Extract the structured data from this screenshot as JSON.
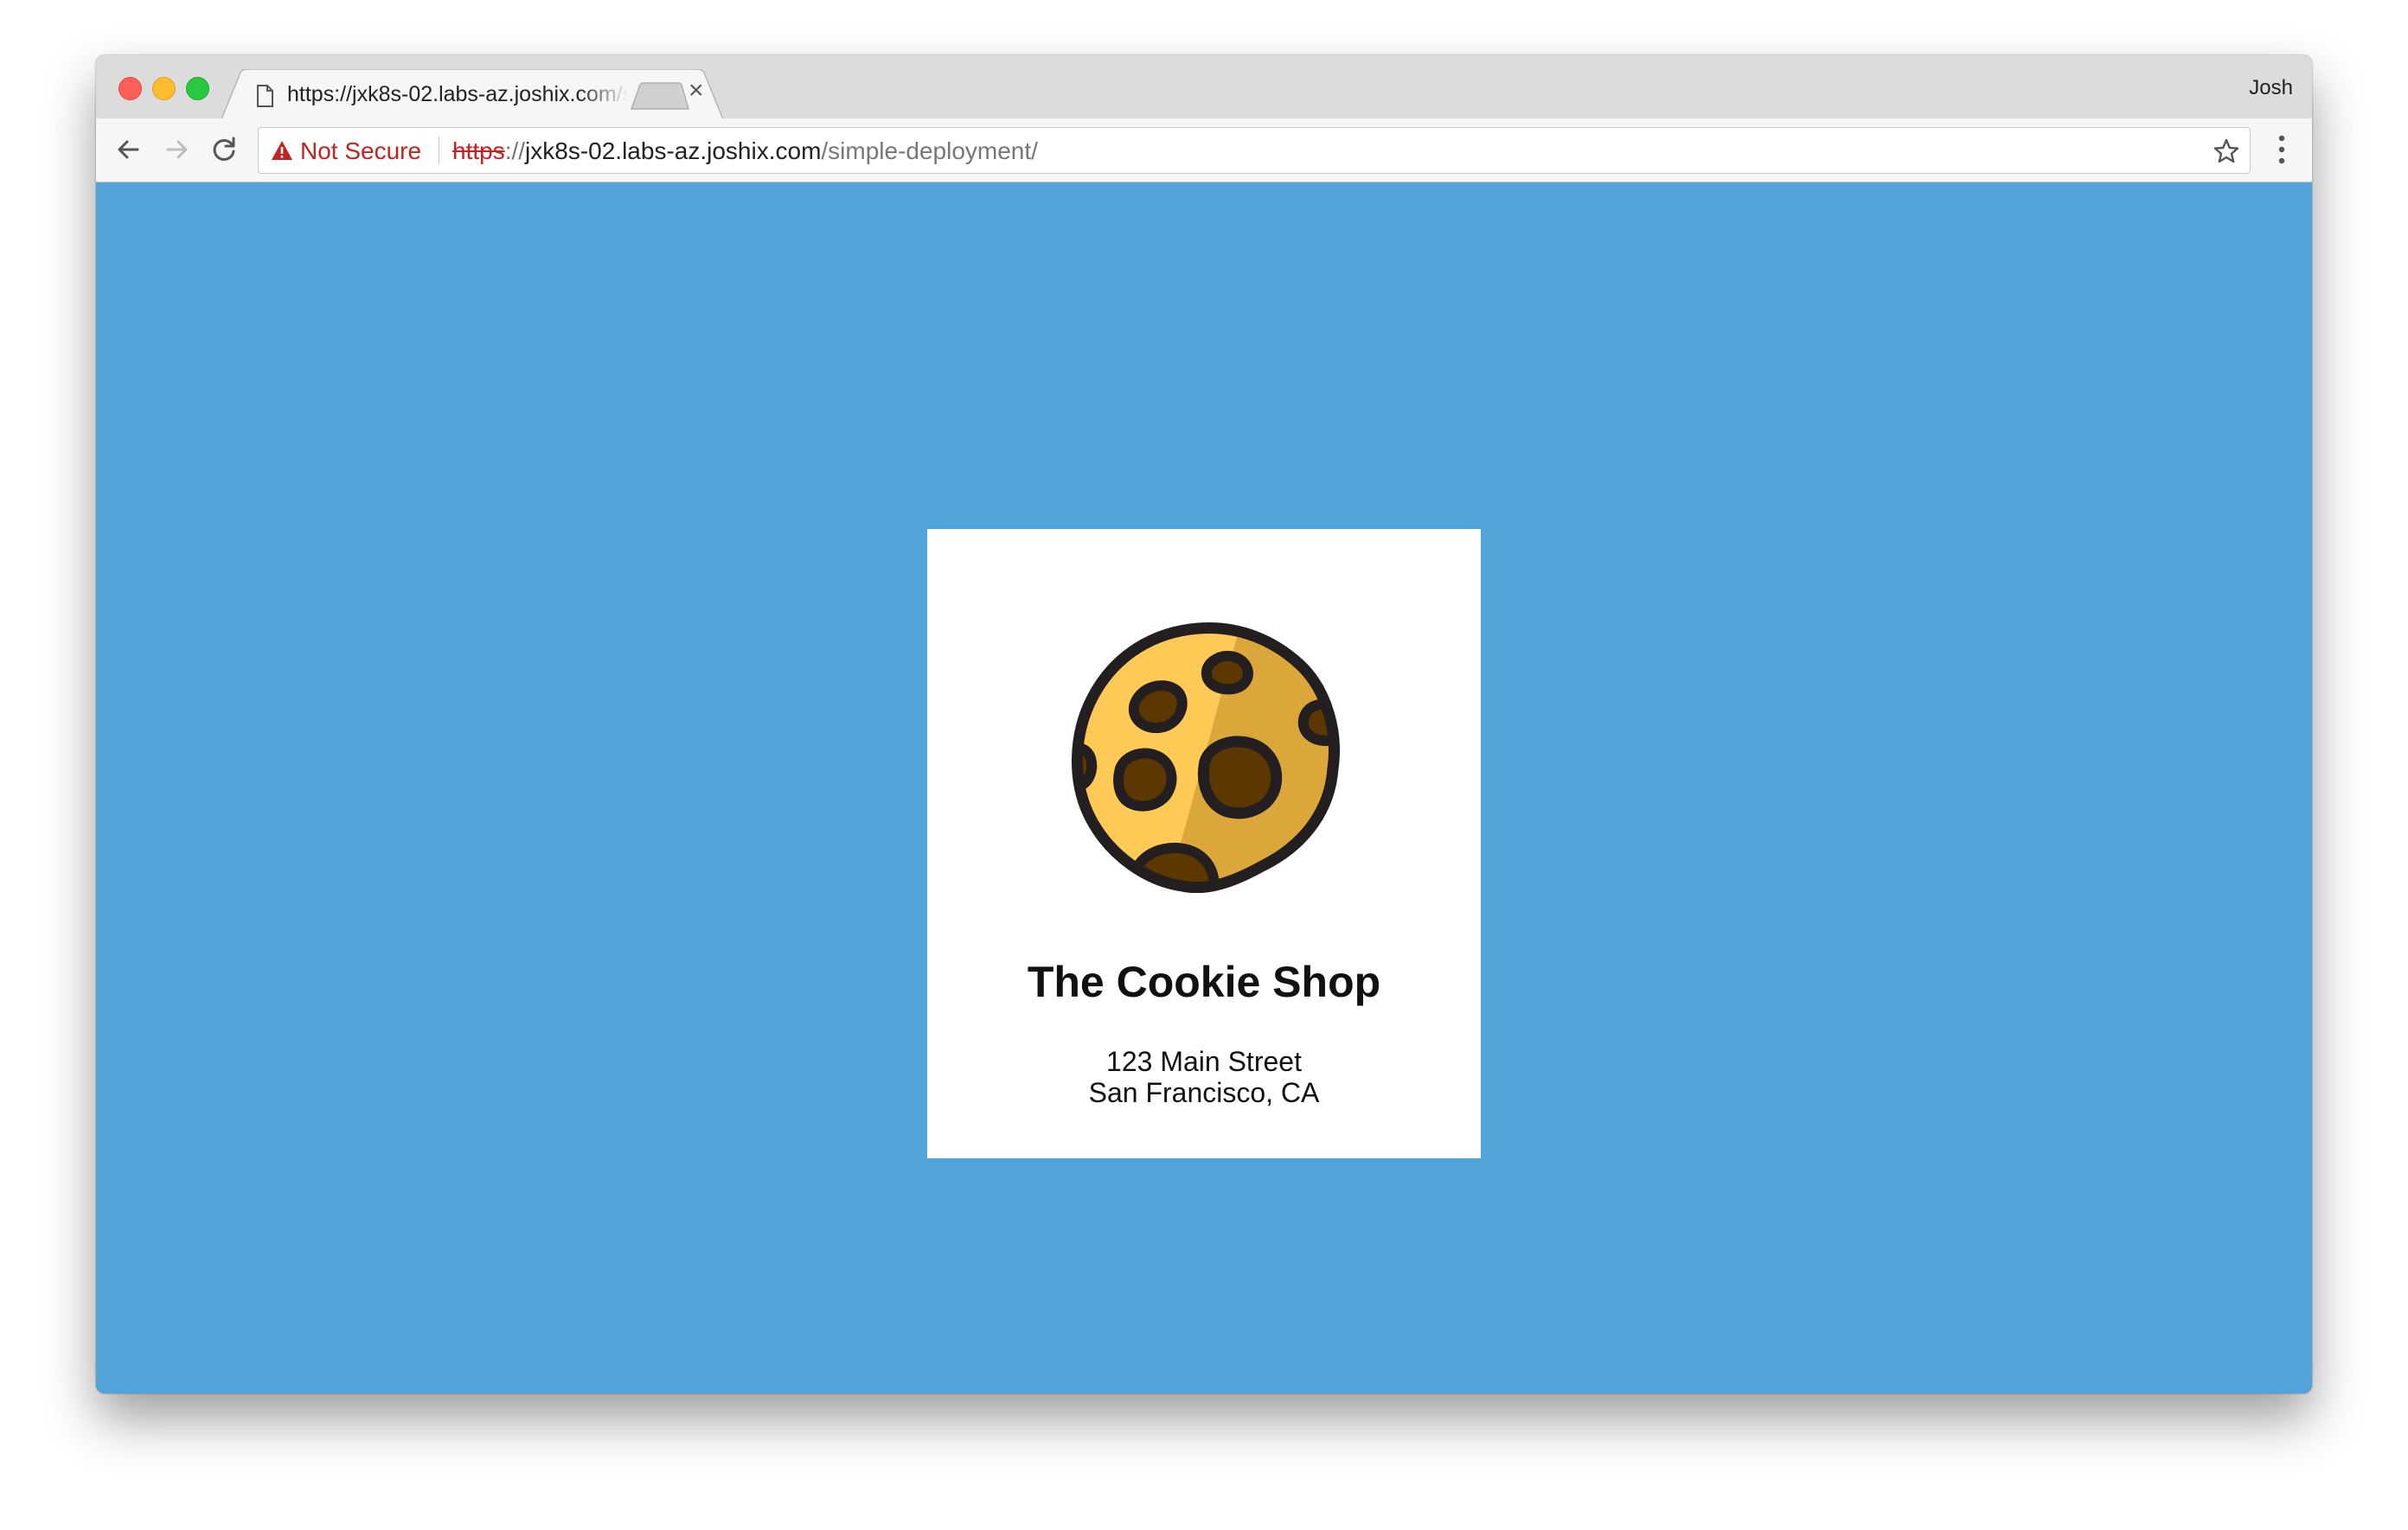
{
  "browser": {
    "tab_title": "https://jxk8s-02.labs-az.joshix.com/simple-deployment/",
    "tab_close": "×",
    "profile_name": "Josh",
    "security_label": "Not Secure",
    "url": {
      "scheme": "https",
      "separator": "://",
      "host": "jxk8s-02.labs-az.joshix.com",
      "path": "/simple-deployment/"
    },
    "icons": {
      "back": "arrow-left-icon",
      "forward": "arrow-right-icon",
      "reload": "reload-icon",
      "warning": "warning-triangle-icon",
      "bookmark": "star-icon",
      "menu": "vertical-dots-icon",
      "page": "document-icon"
    }
  },
  "page": {
    "shop_name": "The Cookie Shop",
    "address_line1": "123 Main Street",
    "address_line2": "San Francisco, CA",
    "logo": "cookie-icon"
  },
  "colors": {
    "page_background": "#51a3d9",
    "card_background": "#ffffff",
    "security_warning": "#c5221f",
    "cookie_light": "#fec955",
    "cookie_dark": "#dba73a",
    "chip": "#5d3700",
    "outline": "#231f20"
  }
}
